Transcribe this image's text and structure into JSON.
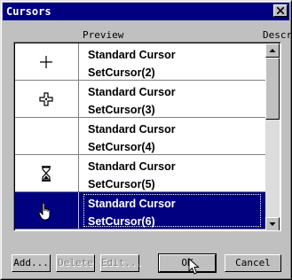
{
  "window": {
    "title": "Cursors"
  },
  "columns": {
    "preview": "Preview",
    "description": "Descr"
  },
  "cursors": [
    {
      "name": "Standard Cursor",
      "id": "SetCursor(2)",
      "icon": "crosshair-icon"
    },
    {
      "name": "Standard Cursor",
      "id": "SetCursor(3)",
      "icon": "move-cross-icon"
    },
    {
      "name": "Standard Cursor",
      "id": "SetCursor(4)",
      "icon": "blank-icon"
    },
    {
      "name": "Standard Cursor",
      "id": "SetCursor(5)",
      "icon": "hourglass-icon"
    },
    {
      "name": "Standard Cursor",
      "id": "SetCursor(6)",
      "icon": "hand-pointer-icon",
      "selected": true
    }
  ],
  "buttons": {
    "add": "Add...",
    "delete": "Delete",
    "edit": "Edit...",
    "ok": "OK",
    "cancel": "Cancel"
  },
  "colors": {
    "titlebar": "#000080",
    "selection": "#000080",
    "face": "#c0c0c0"
  }
}
